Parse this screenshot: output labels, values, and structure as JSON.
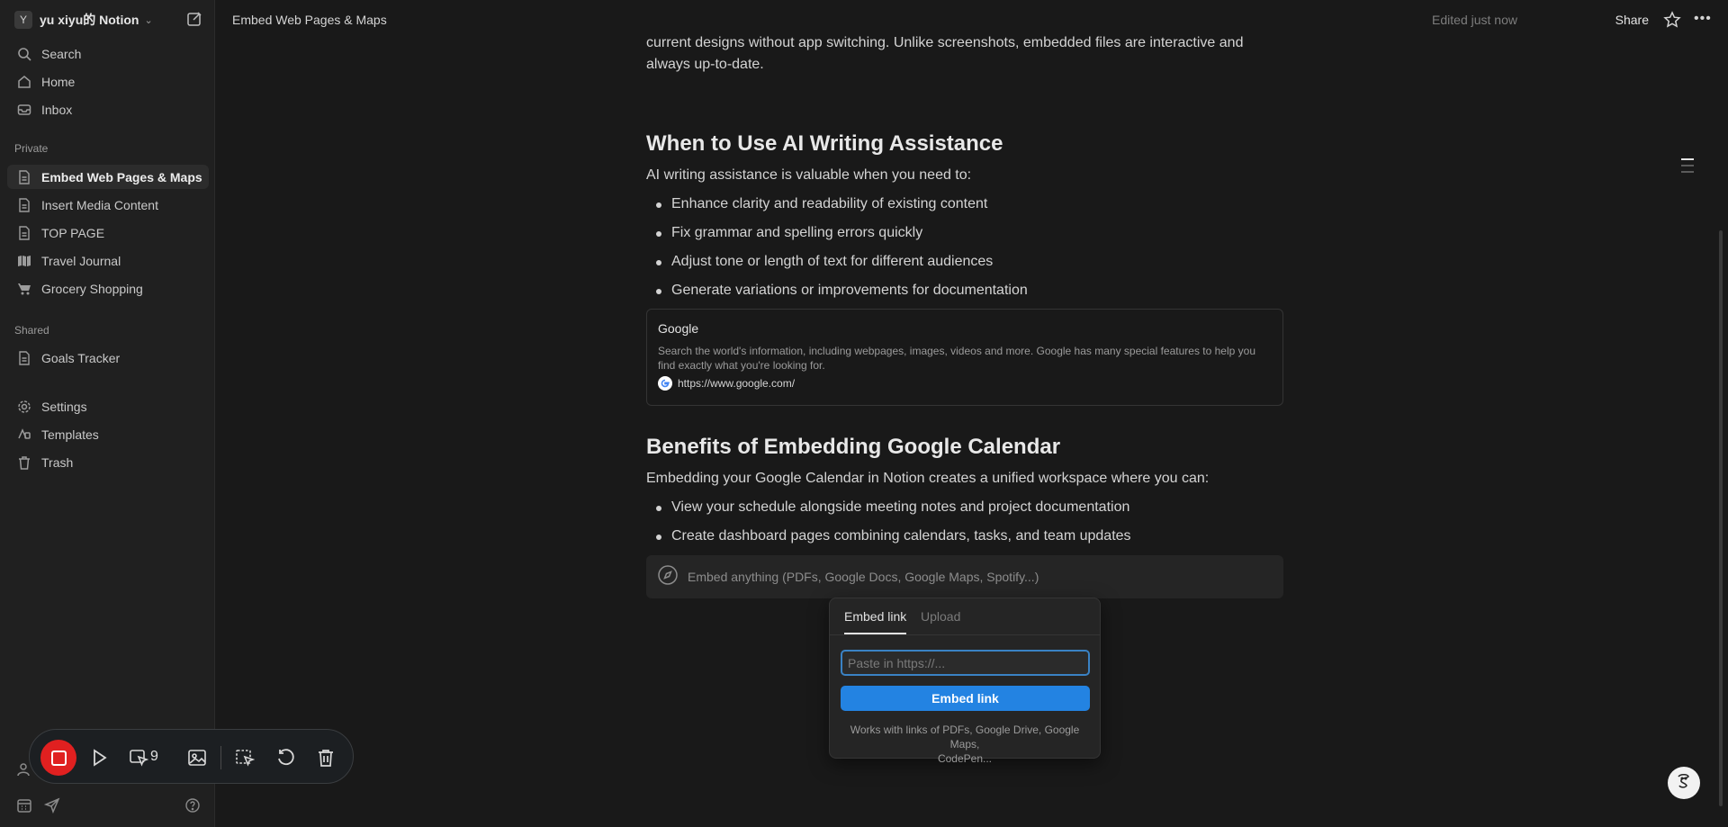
{
  "sidebar": {
    "workspace_initial": "Y",
    "workspace_name": "yu xiyu的 Notion",
    "nav": [
      {
        "label": "Search",
        "icon": "search-icon"
      },
      {
        "label": "Home",
        "icon": "home-icon"
      },
      {
        "label": "Inbox",
        "icon": "inbox-icon"
      }
    ],
    "private_label": "Private",
    "private_pages": [
      {
        "label": "Embed Web Pages & Maps",
        "icon": "page-icon",
        "active": true
      },
      {
        "label": "Insert Media Content",
        "icon": "page-icon"
      },
      {
        "label": "TOP PAGE",
        "icon": "page-icon"
      },
      {
        "label": "Travel Journal",
        "icon": "map-icon"
      },
      {
        "label": "Grocery Shopping",
        "icon": "cart-icon"
      }
    ],
    "shared_label": "Shared",
    "shared_pages": [
      {
        "label": "Goals Tracker",
        "icon": "page-icon"
      }
    ],
    "utilities": [
      {
        "label": "Settings",
        "icon": "gear-icon"
      },
      {
        "label": "Templates",
        "icon": "templates-icon"
      },
      {
        "label": "Trash",
        "icon": "trash-icon"
      }
    ]
  },
  "topbar": {
    "breadcrumb": "Embed Web Pages & Maps",
    "edited": "Edited just now",
    "share": "Share"
  },
  "content": {
    "intro_line1": "current designs without app switching. Unlike screenshots, embedded files are interactive and",
    "intro_line2": "always up-to-date.",
    "h_ai": "When to Use AI Writing Assistance",
    "ai_lead": "AI writing assistance is valuable when you need to:",
    "ai_bullets": [
      "Enhance clarity and readability of existing content",
      "Fix grammar and spelling errors quickly",
      "Adjust tone or length of text for different audiences",
      "Generate variations or improvements for documentation"
    ],
    "bookmark": {
      "title": "Google",
      "description": "Search the world's information, including webpages, images, videos and more. Google has many special features to help you find exactly what you're looking for.",
      "url": "https://www.google.com/"
    },
    "h_cal": "Benefits of Embedding Google Calendar",
    "cal_lead": "Embedding your Google Calendar in Notion creates a unified workspace where you can:",
    "cal_bullets": [
      "View your schedule alongside meeting notes and project documentation",
      "Create dashboard pages combining calendars, tasks, and team updates"
    ],
    "embed_placeholder": "Embed anything (PDFs, Google Docs, Google Maps, Spotify...)"
  },
  "popover": {
    "tab_embed": "Embed link",
    "tab_upload": "Upload",
    "input_placeholder": "Paste in https://...",
    "button": "Embed link",
    "help_line1": "Works with links of PDFs, Google Drive, Google Maps,",
    "help_line2": "CodePen..."
  },
  "recorder": {
    "count": "9"
  },
  "colors": {
    "accent": "#2383e2",
    "record": "#e02020",
    "background": "#191919",
    "sidebar": "#202020"
  }
}
